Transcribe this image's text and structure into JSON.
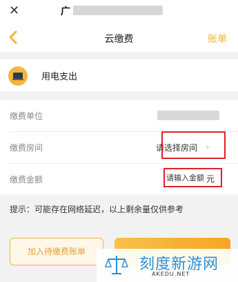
{
  "topbar": {
    "close_icon": "close-icon",
    "title_visible": "广"
  },
  "navbar": {
    "back_icon": "chevron-left-icon",
    "title": "云缴费",
    "right_link": "账单",
    "accent_color": "#f5b23a"
  },
  "service": {
    "icon": "tv-icon",
    "label": "用电支出"
  },
  "form": {
    "unit_label": "缴费单位",
    "room_label": "缴费房间",
    "room_value": "请选择房间",
    "room_chevron": "chevron-right-icon",
    "amount_label": "缴费金额",
    "amount_placeholder": "请输入金额",
    "amount_unit": "元"
  },
  "hint": "提示：可能存在网络延迟，以上剩余量仅供参考",
  "buttons": {
    "add_label": "加入待缴费账单"
  },
  "watermark": {
    "text": "刻度新游网",
    "url": "AKEDU.NET"
  }
}
